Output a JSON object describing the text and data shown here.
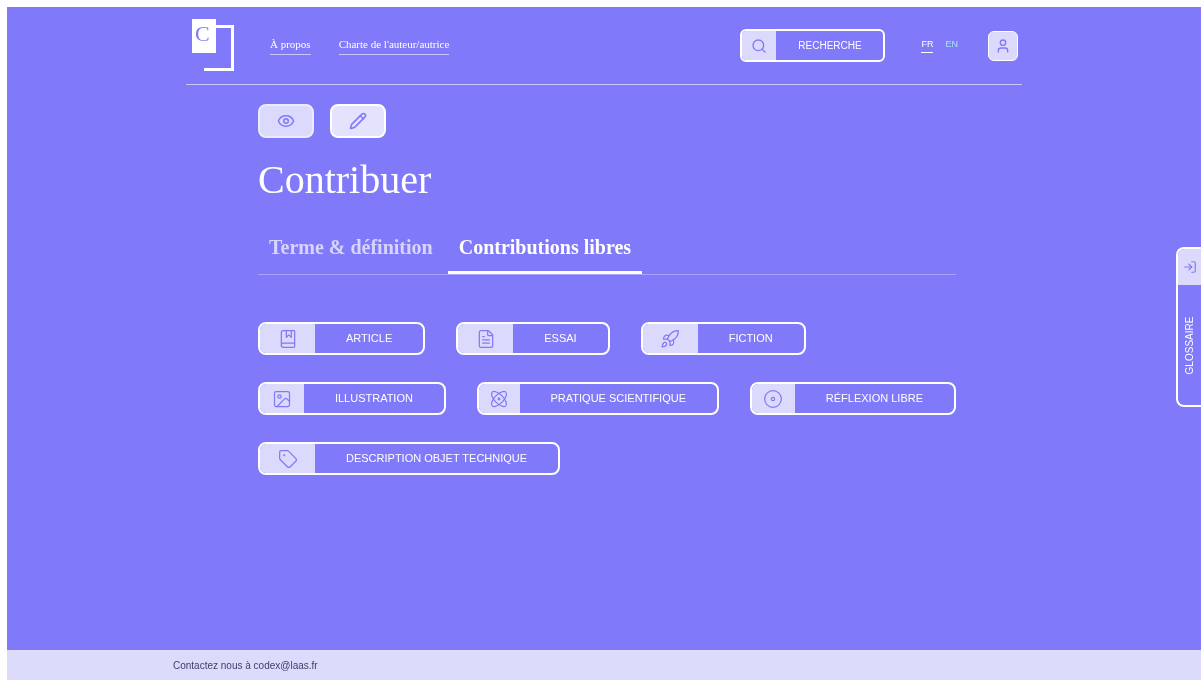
{
  "header": {
    "logo": "C",
    "nav": [
      "À propos",
      "Charte de l'auteur/autrice"
    ],
    "search_button": "RECHERCHE",
    "languages": [
      {
        "label": "FR",
        "selected": true
      },
      {
        "label": "EN",
        "selected": false
      }
    ]
  },
  "mode_buttons": [
    {
      "kind": "view",
      "selected": false
    },
    {
      "kind": "edit",
      "selected": true
    }
  ],
  "title": "Contribuer",
  "tabs": [
    {
      "label": "Terme & définition",
      "selected": false
    },
    {
      "label": "Contributions libres",
      "selected": true
    }
  ],
  "contribution_types": [
    [
      {
        "kind": "article",
        "label": "ARTICLE"
      },
      {
        "kind": "essai",
        "label": "ESSAI"
      },
      {
        "kind": "fiction",
        "label": "FICTION"
      }
    ],
    [
      {
        "kind": "illustration",
        "label": "ILLUSTRATION"
      },
      {
        "kind": "science",
        "label": "PRATIQUE SCIENTIFIQUE"
      },
      {
        "kind": "reflexion",
        "label": "RÉFLEXION LIBRE"
      }
    ],
    [
      {
        "kind": "objet",
        "label": "DESCRIPTION OBJET TECHNIQUE"
      }
    ]
  ],
  "side_tab": {
    "label": "GLOSSAIRE"
  },
  "footer": {
    "text": "Contactez nous à codex@laas.fr"
  }
}
